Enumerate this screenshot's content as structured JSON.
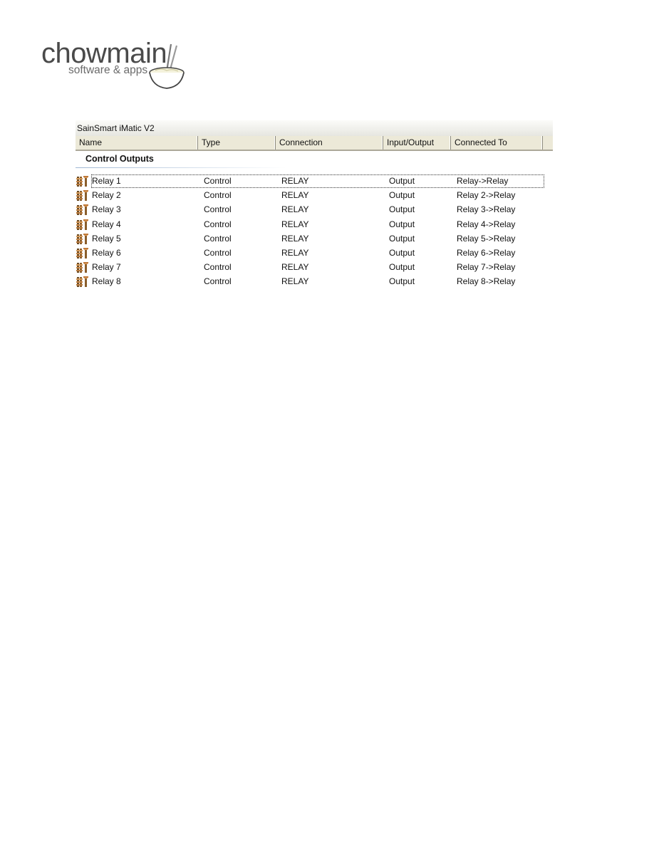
{
  "logo": {
    "wordmark": "chowmain",
    "tagline": "software & apps"
  },
  "panel": {
    "title": "SainSmart iMatic V2",
    "columns": [
      "Name",
      "Type",
      "Connection",
      "Input/Output",
      "Connected To"
    ],
    "group": {
      "label": "Control Outputs",
      "rows": [
        {
          "icon": "relay-connector-icon",
          "name": "Relay 1",
          "type": "Control",
          "connection": "RELAY",
          "io": "Output",
          "connected_to": "Relay->Relay"
        },
        {
          "icon": "relay-connector-icon",
          "name": "Relay 2",
          "type": "Control",
          "connection": "RELAY",
          "io": "Output",
          "connected_to": "Relay 2->Relay"
        },
        {
          "icon": "relay-connector-icon",
          "name": "Relay 3",
          "type": "Control",
          "connection": "RELAY",
          "io": "Output",
          "connected_to": "Relay 3->Relay"
        },
        {
          "icon": "relay-connector-icon",
          "name": "Relay 4",
          "type": "Control",
          "connection": "RELAY",
          "io": "Output",
          "connected_to": "Relay 4->Relay"
        },
        {
          "icon": "relay-connector-icon",
          "name": "Relay 5",
          "type": "Control",
          "connection": "RELAY",
          "io": "Output",
          "connected_to": "Relay 5->Relay"
        },
        {
          "icon": "relay-connector-icon",
          "name": "Relay 6",
          "type": "Control",
          "connection": "RELAY",
          "io": "Output",
          "connected_to": "Relay 6->Relay"
        },
        {
          "icon": "relay-connector-icon",
          "name": "Relay 7",
          "type": "Control",
          "connection": "RELAY",
          "io": "Output",
          "connected_to": "Relay 7->Relay"
        },
        {
          "icon": "relay-connector-icon",
          "name": "Relay 8",
          "type": "Control",
          "connection": "RELAY",
          "io": "Output",
          "connected_to": "Relay 8->Relay"
        }
      ]
    }
  },
  "colors": {
    "header_bg": "#ece9d8",
    "group_line": "#9fb7d3",
    "logo_text": "#4a4a4a"
  }
}
